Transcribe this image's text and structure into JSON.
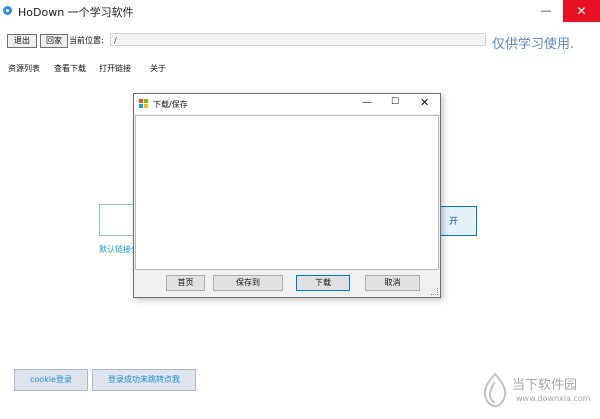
{
  "window": {
    "title": "HoDown  一个学习软件",
    "min_icon": "—",
    "max_icon": "☐",
    "close_icon": "✕"
  },
  "toolbar": {
    "exit_label": "退出",
    "home_label": "回家",
    "path_label": "当前位置:",
    "path_value": "/",
    "study_note": "仅供学习使用."
  },
  "menu": [
    {
      "label": "资源列表"
    },
    {
      "label": "查看下载"
    },
    {
      "label": "打开链接"
    },
    {
      "label": "关于"
    }
  ],
  "main": {
    "open_button_label": "开",
    "default_link_text": "默认链接分"
  },
  "bottom": {
    "cookie_login_label": "cookie登录",
    "jump_label": "登录成功未跳转点我"
  },
  "dialog": {
    "title": "下载/保存",
    "min_icon": "—",
    "max_icon": "☐",
    "close_icon": "✕",
    "buttons": {
      "home": "首页",
      "save_to": "保存到",
      "download": "下载",
      "cancel": "取消"
    }
  },
  "watermark": {
    "text": "当下软件园",
    "url": "www.downxia.com"
  },
  "colors": {
    "accent": "#0078d7",
    "link": "#1696d2",
    "close_red": "#e81123",
    "note_blue": "#5e86c4"
  },
  "icons": [
    "app-icon",
    "minimize-icon",
    "maximize-icon",
    "close-icon",
    "dialog-app-icon",
    "resize-grip-icon",
    "watermark-logo-icon"
  ]
}
